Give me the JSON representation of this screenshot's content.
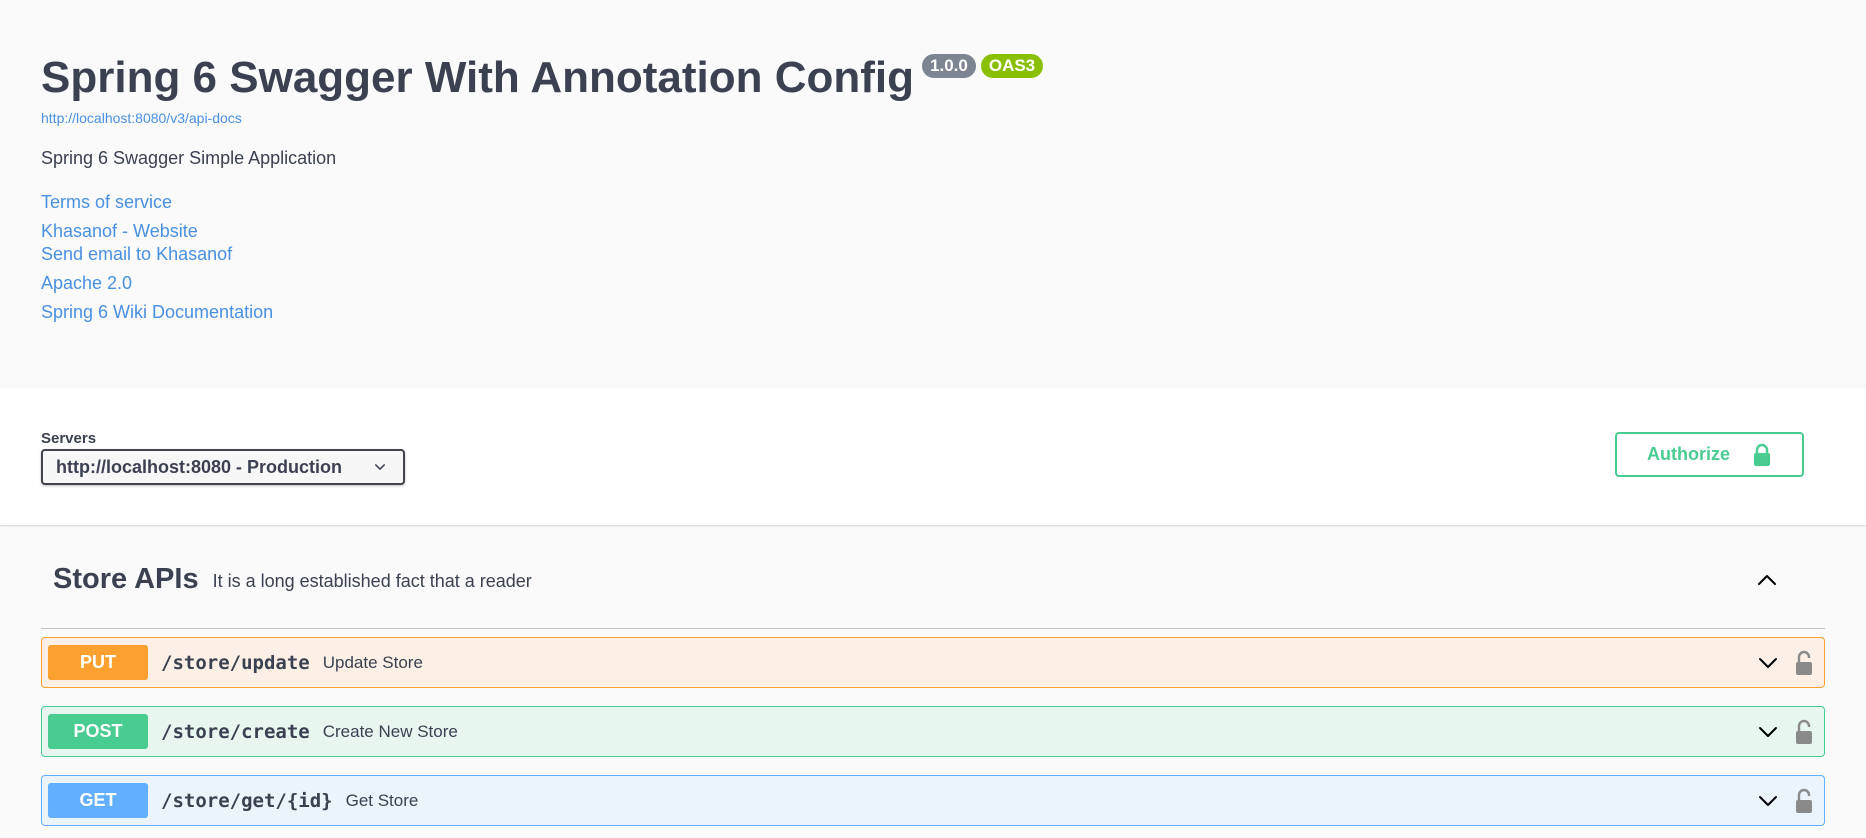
{
  "info": {
    "title": "Spring 6 Swagger With Annotation Config",
    "version_badge": "1.0.0",
    "oas_badge": "OAS3",
    "spec_url": "http://localhost:8080/v3/api-docs",
    "description": "Spring 6 Swagger Simple Application",
    "links": {
      "terms": "Terms of service",
      "contact_website": "Khasanof - Website",
      "contact_email": "Send email to Khasanof",
      "license": "Apache 2.0",
      "external_docs": "Spring 6 Wiki Documentation"
    }
  },
  "servers": {
    "label": "Servers",
    "selected": "http://localhost:8080 - Production"
  },
  "authorize": {
    "label": "Authorize"
  },
  "tag": {
    "name": "Store APIs",
    "description": "It is a long established fact that a reader"
  },
  "operations": [
    {
      "method": "PUT",
      "path": "/store/update",
      "summary": "Update Store"
    },
    {
      "method": "POST",
      "path": "/store/create",
      "summary": "Create New Store"
    },
    {
      "method": "GET",
      "path": "/store/get/{id}",
      "summary": "Get Store"
    }
  ],
  "icons": {
    "server_dropdown": "chevron-down-icon",
    "authorize": "lock-icon",
    "tag_toggle": "chevron-up-icon",
    "operation_expand": "chevron-down-icon",
    "operation_lock": "lock-icon"
  },
  "colors": {
    "put": "#fca130",
    "post": "#49cc90",
    "get": "#61affe",
    "link": "#4990e2",
    "version_badge": "#7d8492",
    "oas_badge": "#89bf04"
  }
}
